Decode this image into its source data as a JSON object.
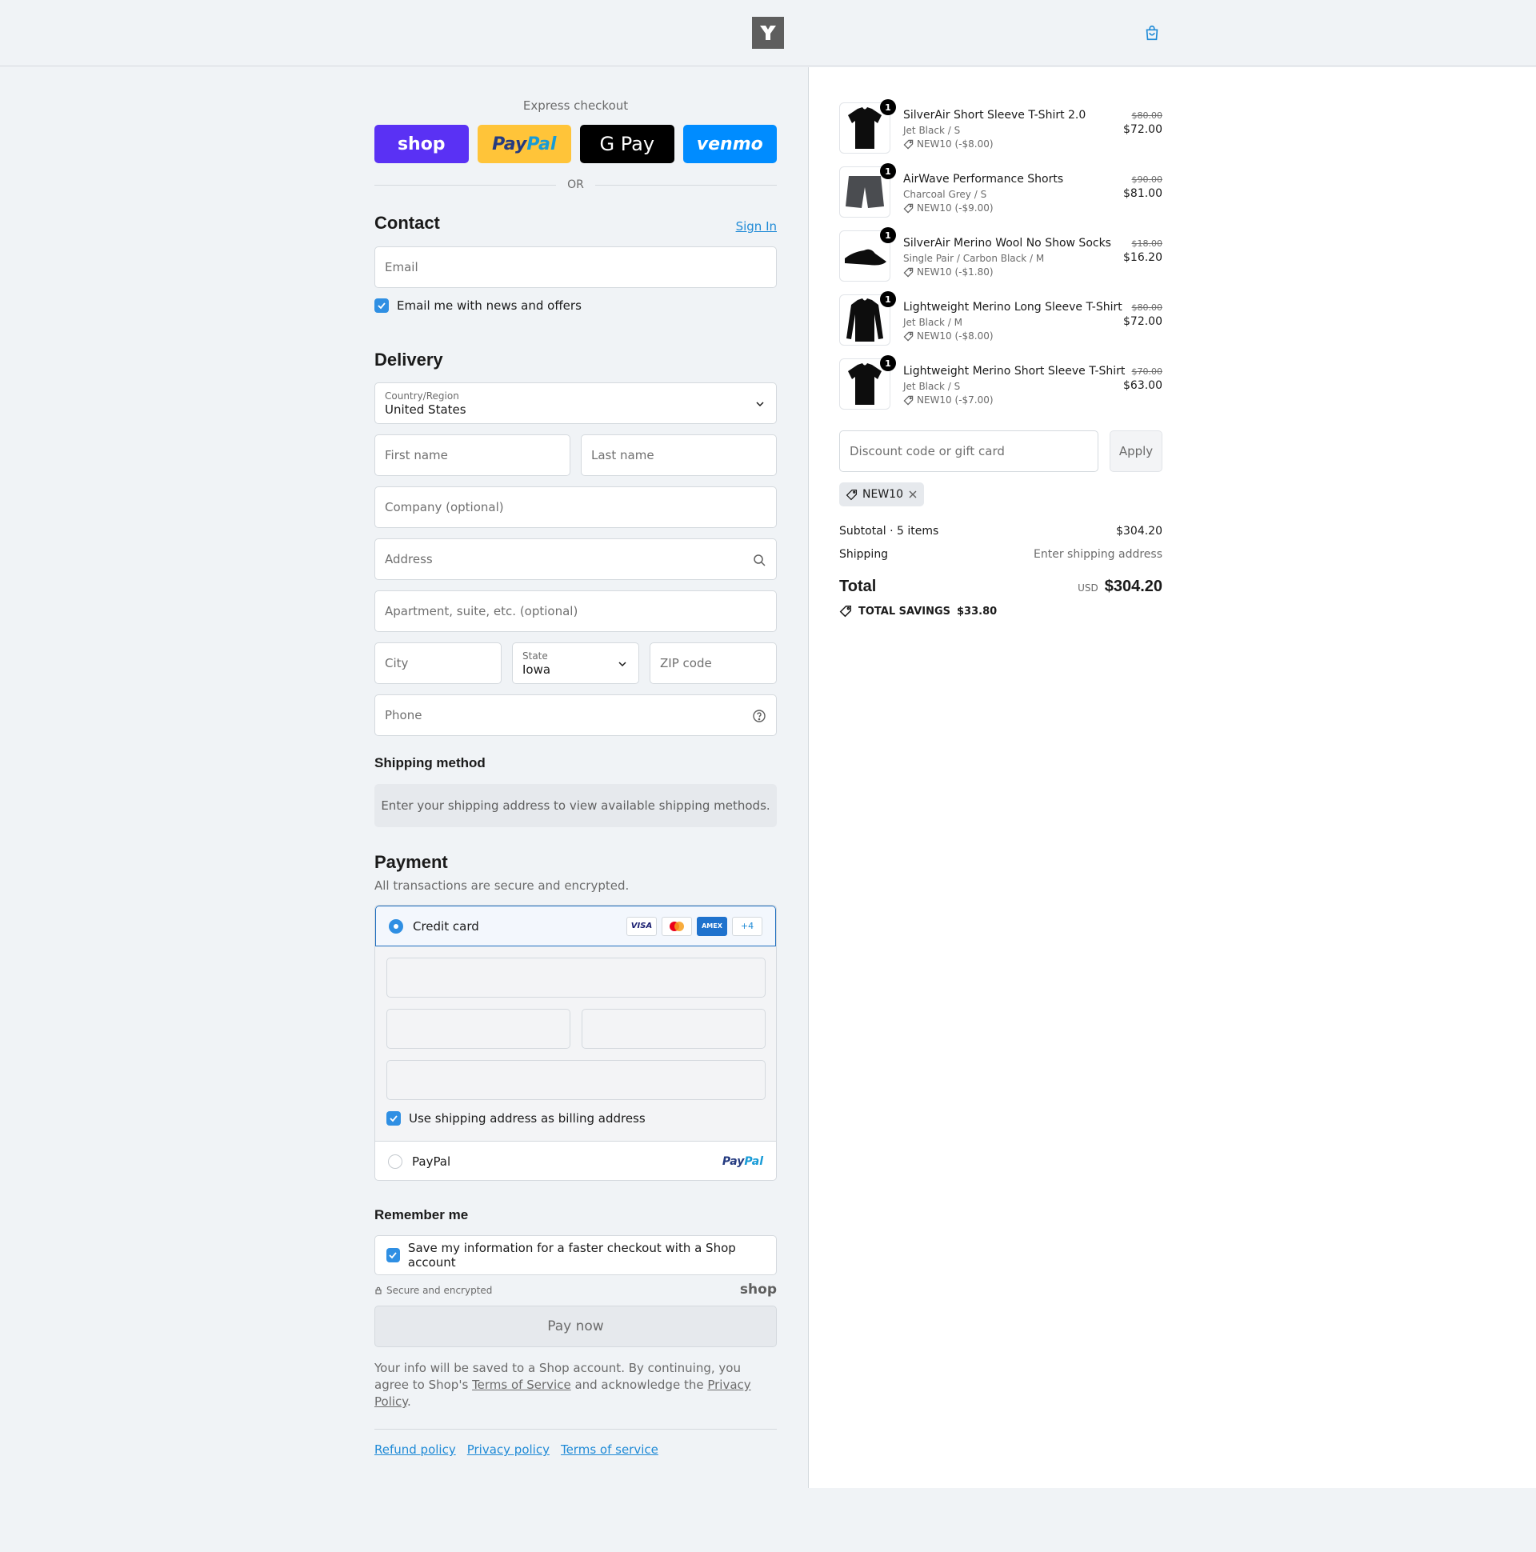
{
  "header": {
    "logo_alt": "Y",
    "cart_icon": "shopping-bag-icon"
  },
  "express": {
    "title": "Express checkout",
    "shop_label": "shop",
    "paypal_label_1": "Pay",
    "paypal_label_2": "Pal",
    "gpay_label": "G Pay",
    "venmo_label": "venmo",
    "or_label": "OR"
  },
  "contact": {
    "title": "Contact",
    "sign_in": "Sign In",
    "email_placeholder": "Email",
    "newsletter_label": "Email me with news and offers"
  },
  "delivery": {
    "title": "Delivery",
    "country_label": "Country/Region",
    "country_value": "United States",
    "first_name_placeholder": "First name",
    "last_name_placeholder": "Last name",
    "company_placeholder": "Company (optional)",
    "address_placeholder": "Address",
    "apartment_placeholder": "Apartment, suite, etc. (optional)",
    "city_placeholder": "City",
    "state_label": "State",
    "state_value": "Iowa",
    "zip_placeholder": "ZIP code",
    "phone_placeholder": "Phone"
  },
  "shipping": {
    "title": "Shipping method",
    "info": "Enter your shipping address to view available shipping methods."
  },
  "payment": {
    "title": "Payment",
    "subtitle": "All transactions are secure and encrypted.",
    "credit_card_label": "Credit card",
    "card_visa": "VISA",
    "card_amex": "AMEX",
    "card_more": "+4",
    "billing_label": "Use shipping address as billing address",
    "paypal_label": "PayPal",
    "paypal_logo_1": "Pay",
    "paypal_logo_2": "Pal"
  },
  "remember": {
    "title": "Remember me",
    "save_label": "Save my information for a faster checkout with a Shop account",
    "secure_label": "Secure and encrypted",
    "shop_word": "shop"
  },
  "pay_now": "Pay now",
  "legal": {
    "text_1": "Your info will be saved to a Shop account. By continuing, you agree to Shop's",
    "terms_link": "Terms of Service",
    "text_2": " and acknowledge the ",
    "privacy_link": "Privacy Policy",
    "text_3": "."
  },
  "footer": {
    "refund": "Refund policy",
    "privacy": "Privacy policy",
    "terms": "Terms of service"
  },
  "cart": {
    "items": [
      {
        "name": "SilverAir Short Sleeve T-Shirt 2.0",
        "variant": "Jet Black / S",
        "discount": "NEW10 (-$8.00)",
        "old_price": "$80.00",
        "price": "$72.00",
        "qty": "1",
        "icon": "tshirt-icon"
      },
      {
        "name": "AirWave Performance Shorts",
        "variant": "Charcoal Grey / S",
        "discount": "NEW10 (-$9.00)",
        "old_price": "$90.00",
        "price": "$81.00",
        "qty": "1",
        "icon": "shorts-icon"
      },
      {
        "name": "SilverAir Merino Wool No Show Socks",
        "variant": "Single Pair / Carbon Black / M",
        "discount": "NEW10 (-$1.80)",
        "old_price": "$18.00",
        "price": "$16.20",
        "qty": "1",
        "icon": "socks-icon"
      },
      {
        "name": "Lightweight Merino Long Sleeve T-Shirt",
        "variant": "Jet Black / M",
        "discount": "NEW10 (-$8.00)",
        "old_price": "$80.00",
        "price": "$72.00",
        "qty": "1",
        "icon": "longsleeve-icon"
      },
      {
        "name": "Lightweight Merino Short Sleeve T-Shirt",
        "variant": "Jet Black / S",
        "discount": "NEW10 (-$7.00)",
        "old_price": "$70.00",
        "price": "$63.00",
        "qty": "1",
        "icon": "tshirt-icon"
      }
    ],
    "discount_placeholder": "Discount code or gift card",
    "apply_label": "Apply",
    "applied_code": "NEW10",
    "subtotal_label": "Subtotal · 5 items",
    "subtotal_value": "$304.20",
    "shipping_label": "Shipping",
    "shipping_value": "Enter shipping address",
    "total_label": "Total",
    "currency": "USD",
    "total_value": "$304.20",
    "savings_label": "TOTAL SAVINGS",
    "savings_value": "$33.80"
  },
  "colors": {
    "accent": "#2f8fe3",
    "link": "#1f8ad6",
    "shop_purple": "#5a31f4",
    "paypal_yellow": "#ffc439",
    "venmo_blue": "#008cff"
  }
}
